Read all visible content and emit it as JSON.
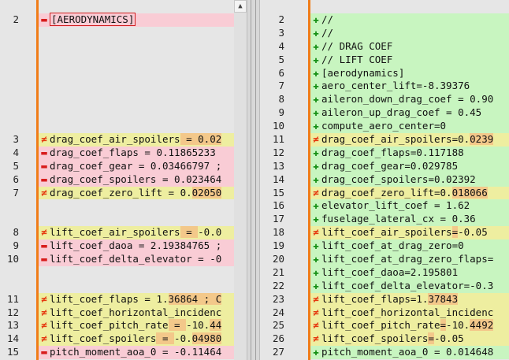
{
  "colors": {
    "removed": "#f9ccd5",
    "added": "#c8f5c0",
    "changed": "#eeeea0",
    "highlight": "#f3c88a",
    "margin": "#f07c18"
  },
  "left_pane": {
    "lines": [
      {
        "num": "2",
        "type": "removed",
        "mark": "minus",
        "text": "[AERODYNAMICS]",
        "boxed": true
      },
      {
        "num": "",
        "type": "blank",
        "mark": "",
        "text": ""
      },
      {
        "num": "",
        "type": "blank",
        "mark": "",
        "text": ""
      },
      {
        "num": "",
        "type": "blank",
        "mark": "",
        "text": ""
      },
      {
        "num": "",
        "type": "blank",
        "mark": "",
        "text": ""
      },
      {
        "num": "",
        "type": "blank",
        "mark": "",
        "text": ""
      },
      {
        "num": "",
        "type": "blank",
        "mark": "",
        "text": ""
      },
      {
        "num": "",
        "type": "blank",
        "mark": "",
        "text": ""
      },
      {
        "num": "",
        "type": "blank",
        "mark": "",
        "text": ""
      },
      {
        "num": "3",
        "type": "changed",
        "mark": "neq",
        "text": "drag_coef_air_spoilers",
        "hl": " = 0.02"
      },
      {
        "num": "4",
        "type": "removed",
        "mark": "minus",
        "text": "drag_coef_flaps = 0.11865233"
      },
      {
        "num": "5",
        "type": "removed",
        "mark": "minus",
        "text": "drag_coef_gear = 0.03466797 ;"
      },
      {
        "num": "6",
        "type": "removed",
        "mark": "minus",
        "text": "drag_coef_spoilers = 0.023464"
      },
      {
        "num": "7",
        "type": "changed",
        "mark": "neq",
        "text": "drag_coef_zero_lift = 0.",
        "hl": "02050"
      },
      {
        "num": "",
        "type": "blank",
        "mark": "",
        "text": ""
      },
      {
        "num": "",
        "type": "blank",
        "mark": "",
        "text": ""
      },
      {
        "num": "8",
        "type": "changed",
        "mark": "neq",
        "text": "lift_coef_air_spoilers",
        "hl": " = ",
        "tail": "-0.0"
      },
      {
        "num": "9",
        "type": "removed",
        "mark": "minus",
        "text": "lift_coef_daoa = 2.19384765 ;"
      },
      {
        "num": "10",
        "type": "removed",
        "mark": "minus",
        "text": "lift_coef_delta_elevator = -0"
      },
      {
        "num": "",
        "type": "blank",
        "mark": "",
        "text": ""
      },
      {
        "num": "",
        "type": "blank",
        "mark": "",
        "text": ""
      },
      {
        "num": "11",
        "type": "changed",
        "mark": "neq",
        "text": "lift_coef_flaps = 1.",
        "hl": "36864 ; C"
      },
      {
        "num": "12",
        "type": "changed",
        "mark": "neq",
        "text": "lift_coef_horizontal_incidenc"
      },
      {
        "num": "13",
        "type": "changed",
        "mark": "neq",
        "text": "lift_coef_pitch_rate",
        "hl": " = ",
        "tail": "-10.",
        "hl2": "44"
      },
      {
        "num": "14",
        "type": "changed",
        "mark": "neq",
        "text": "lift_coef_spoilers",
        "hl": " = ",
        "tail": "-0.",
        "hl2": "04980"
      },
      {
        "num": "15",
        "type": "removed",
        "mark": "minus",
        "text": "pitch_moment_aoa_0 = -0.11464"
      }
    ]
  },
  "right_pane": {
    "lines": [
      {
        "num": "2",
        "type": "added",
        "mark": "plus",
        "text": "//"
      },
      {
        "num": "3",
        "type": "added",
        "mark": "plus",
        "text": "//"
      },
      {
        "num": "4",
        "type": "added",
        "mark": "plus",
        "text": "// DRAG COEF"
      },
      {
        "num": "5",
        "type": "added",
        "mark": "plus",
        "text": "// LIFT COEF"
      },
      {
        "num": "6",
        "type": "added",
        "mark": "plus",
        "text": "[aerodynamics]"
      },
      {
        "num": "7",
        "type": "added",
        "mark": "plus",
        "text": "aero_center_lift=-8.39376"
      },
      {
        "num": "8",
        "type": "added",
        "mark": "plus",
        "text": "aileron_down_drag_coef = 0.90"
      },
      {
        "num": "9",
        "type": "added",
        "mark": "plus",
        "text": "aileron_up_drag_coef = 0.45"
      },
      {
        "num": "10",
        "type": "added",
        "mark": "plus",
        "text": "compute_aero_center=0"
      },
      {
        "num": "11",
        "type": "changed",
        "mark": "neq",
        "text": "drag_coef_air_spoilers=0.",
        "hl": "0239"
      },
      {
        "num": "12",
        "type": "added",
        "mark": "plus",
        "text": "drag_coef_flaps=0.117188"
      },
      {
        "num": "13",
        "type": "added",
        "mark": "plus",
        "text": "drag_coef_gear=0.029785"
      },
      {
        "num": "14",
        "type": "added",
        "mark": "plus",
        "text": "drag_coef_spoilers=0.02392"
      },
      {
        "num": "15",
        "type": "changed",
        "mark": "neq",
        "text": "drag_coef_zero_lift=0.",
        "hl": "018066"
      },
      {
        "num": "16",
        "type": "added",
        "mark": "plus",
        "text": "elevator_lift_coef = 1.62"
      },
      {
        "num": "17",
        "type": "added",
        "mark": "plus",
        "text": "fuselage_lateral_cx = 0.36"
      },
      {
        "num": "18",
        "type": "changed",
        "mark": "neq",
        "text": "lift_coef_air_spoilers",
        "hl": "=",
        "tail": "-0.05"
      },
      {
        "num": "19",
        "type": "added",
        "mark": "plus",
        "text": "lift_coef_at_drag_zero=0"
      },
      {
        "num": "20",
        "type": "added",
        "mark": "plus",
        "text": "lift_coef_at_drag_zero_flaps="
      },
      {
        "num": "21",
        "type": "added",
        "mark": "plus",
        "text": "lift_coef_daoa=2.195801"
      },
      {
        "num": "22",
        "type": "added",
        "mark": "plus",
        "text": "lift_coef_delta_elevator=-0.3"
      },
      {
        "num": "23",
        "type": "changed",
        "mark": "neq",
        "text": "lift_coef_flaps=1.",
        "hl": "37843"
      },
      {
        "num": "24",
        "type": "changed",
        "mark": "neq",
        "text": "lift_coef_horizontal_incidenc"
      },
      {
        "num": "25",
        "type": "changed",
        "mark": "neq",
        "text": "lift_coef_pitch_rate",
        "hl": "=",
        "tail": "-10.",
        "hl2": "4492"
      },
      {
        "num": "26",
        "type": "changed",
        "mark": "neq",
        "text": "lift_coef_spoilers",
        "hl": "=",
        "tail": "-0.05"
      },
      {
        "num": "27",
        "type": "added",
        "mark": "plus",
        "text": "pitch_moment_aoa_0 = 0.014648"
      }
    ]
  }
}
